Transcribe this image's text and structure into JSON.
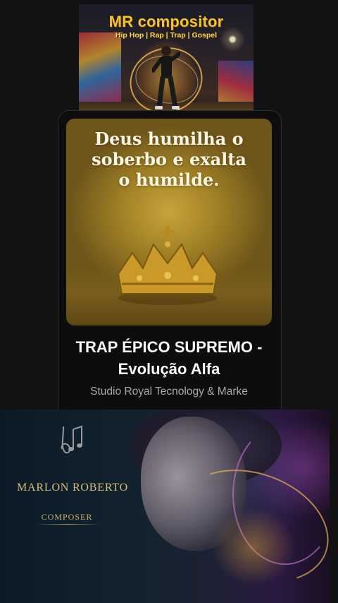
{
  "banner": {
    "title": "MR compositor",
    "subtitle": "Hip Hop | Rap | Trap | Gospel"
  },
  "card": {
    "cover_text_lines": [
      "Deus humilha o",
      "soberbo e exalta",
      "o humilde."
    ],
    "title_line1": "TRAP ÉPICO SUPREMO -",
    "title_line2": "Evolução Alfa",
    "artist": "Studio Royal Tecnology & Marke"
  },
  "poster": {
    "name": "MARLON ROBERTO",
    "role": "COMPOSER"
  },
  "colors": {
    "background": "#121212",
    "card": "#0d0d0d",
    "banner_title": "#f2c230",
    "poster_gold": "#d8bd7a",
    "artist_text": "#a9a9a9"
  },
  "icons": [
    "music-logo-icon",
    "crown-icon"
  ]
}
